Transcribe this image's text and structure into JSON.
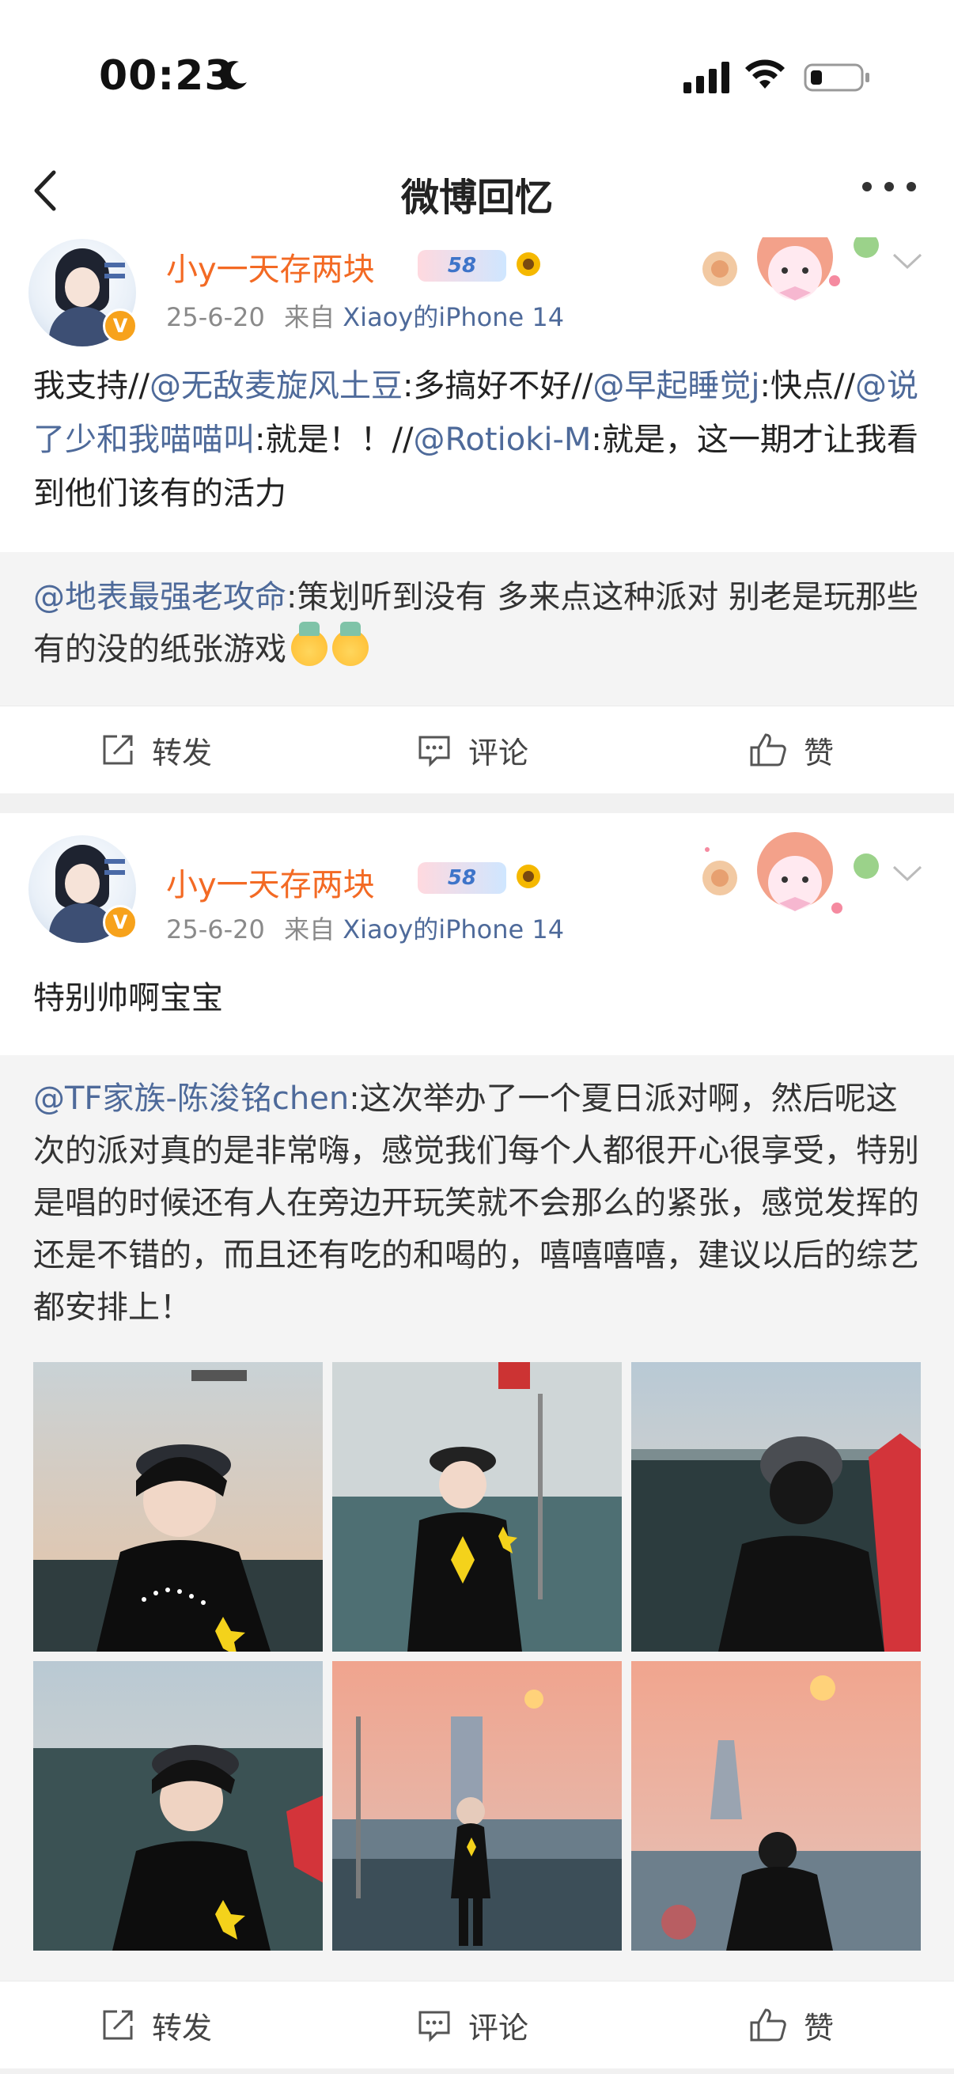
{
  "status_bar": {
    "time": "00:23"
  },
  "nav": {
    "title": "微博回忆"
  },
  "posts": [
    {
      "username": "小y一天存两块",
      "level": "58",
      "date": "25-6-20",
      "source_prefix": "来自",
      "device": "Xiaoy的iPhone 14",
      "content": {
        "t1": "我支持//",
        "m1": "@无敌麦旋风土豆",
        "t2": ":多搞好不好//",
        "m2": "@早起睡觉j",
        "t3": ":快点//",
        "m3": "@说了少和我喵喵叫",
        "t4": ":就是！！//",
        "m4": "@Rotioki-M",
        "t5": ":就是，这一期才让我看到他们该有的活力"
      },
      "quote": {
        "mention": "@地表最强老攻命",
        "text": ":策划听到没有 多来点这种派对 别老是玩那些有的没的纸张游戏"
      },
      "actions": {
        "repost": "转发",
        "comment": "评论",
        "like": "赞"
      }
    },
    {
      "username": "小y一天存两块",
      "level": "58",
      "date": "25-6-20",
      "source_prefix": "来自",
      "device": "Xiaoy的iPhone 14",
      "content": "特别帅啊宝宝",
      "quote": {
        "mention": "@TF家族-陈浚铭chen",
        "text": ":这次举办了一个夏日派对啊，然后呢这次的派对真的是非常嗨，感觉我们每个人都很开心很享受，特别是唱的时候还有人在旁边开玩笑就不会那么的紧张，感觉发挥的还是不错的，而且还有吃的和喝的，嘻嘻嘻嘻，建议以后的综艺都安排上！"
      },
      "photos": [
        "photo-1",
        "photo-2",
        "photo-3",
        "photo-4",
        "photo-5",
        "photo-6"
      ],
      "actions": {
        "repost": "转发",
        "comment": "评论",
        "like": "赞"
      }
    }
  ],
  "colors": {
    "username": "#f36a24",
    "mention": "#4e6a9a",
    "meta": "#8a8a8a",
    "quote_bg": "#f4f4f4"
  }
}
